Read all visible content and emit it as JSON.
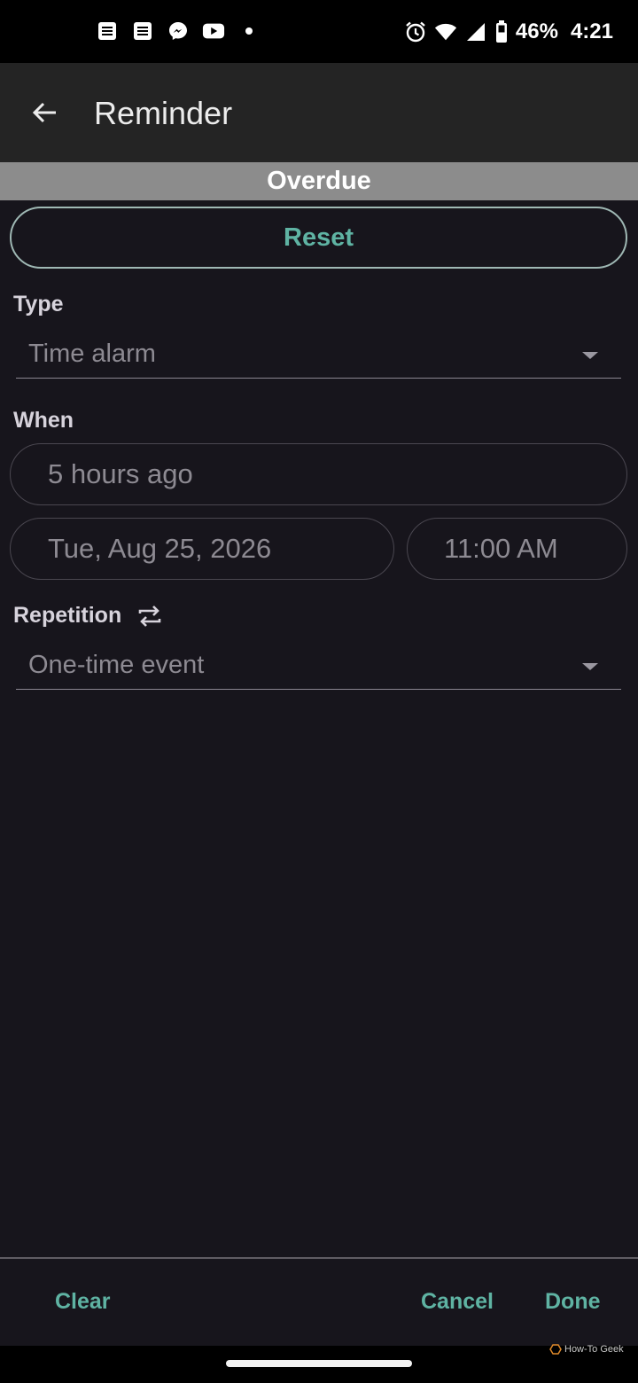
{
  "status_bar": {
    "notification_icons": [
      "news-icon",
      "news-icon",
      "messenger-icon",
      "youtube-icon",
      "dot-icon"
    ],
    "system_icons": [
      "alarm-icon",
      "wifi-icon",
      "cell-signal-icon",
      "battery-icon"
    ],
    "battery": "46%",
    "time": "4:21"
  },
  "app_bar": {
    "back_icon": "arrow-left-icon",
    "title": "Reminder"
  },
  "banner": {
    "status": "Overdue"
  },
  "reset_button": "Reset",
  "type_section": {
    "label": "Type",
    "selected": "Time alarm"
  },
  "when_section": {
    "label": "When",
    "relative": "5 hours ago",
    "date": "Tue, Aug 25, 2026",
    "time": "11:00 AM"
  },
  "repetition_section": {
    "label": "Repetition",
    "icon": "repeat-icon",
    "selected": "One-time event"
  },
  "actions": {
    "clear": "Clear",
    "cancel": "Cancel",
    "done": "Done"
  },
  "watermark": "How-To Geek",
  "colors": {
    "accent": "#5fb3a3",
    "background": "#17151c",
    "app_bar": "#242424",
    "banner": "#8c8c8c"
  }
}
